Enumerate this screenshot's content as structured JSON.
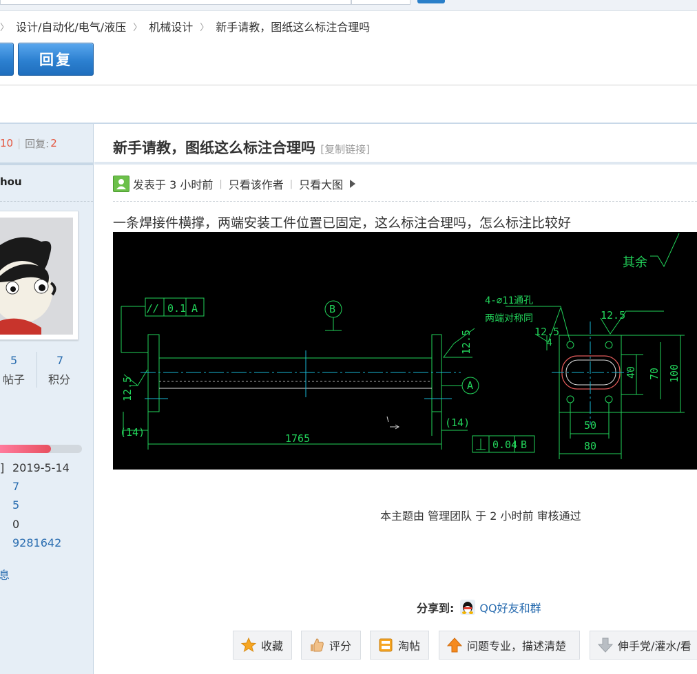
{
  "breadcrumb": {
    "items": [
      "设计/自动化/电气/液压",
      "机械设计",
      "新手请教，图纸这么标注合理吗"
    ]
  },
  "toolbar": {
    "reply_label": "回复"
  },
  "thread_stats": {
    "views_label": "10",
    "replies_prefix": "回复:",
    "replies": "2"
  },
  "author": {
    "name_partial": "hou",
    "posts_count": "5",
    "posts_label": "帖子",
    "points_count": "7",
    "points_label": "积分",
    "level_progress_percent": 62,
    "info_bracket": "]",
    "info_values": [
      "2019-5-14",
      "7",
      "5",
      "0",
      "9281642"
    ],
    "info_link": "息"
  },
  "post": {
    "title": "新手请教，图纸这么标注合理吗",
    "copy_link": "[复制链接]",
    "posted_time": "发表于 3 小时前",
    "only_author": "只看该作者",
    "only_big_image": "只看大图",
    "body": "一条焊接件横撑，两端安装工件位置已固定，这么标注合理吗，怎么标注比较好",
    "audit_note": "本主题由 管理团队 于 2 小时前 审核通过"
  },
  "drawing_labels": {
    "rest": "其余",
    "tol_val": "0.1",
    "tol_ref": "A",
    "datum_b": "B",
    "datum_a": "A",
    "hole_note": "4-⌀11通孔",
    "hole_note2": "两端对称同",
    "rough1": "12.5",
    "rough2": "12.5",
    "rough3": "12.5",
    "rough4": "12.5",
    "dim_4": "4",
    "dim_40": "40",
    "dim_70": "70",
    "dim_100": "100",
    "dim_50": "50",
    "dim_80": "80",
    "dim_14a": "(14)",
    "dim_14b": "(14)",
    "dim_1765": "1765",
    "perp_val": "0.04",
    "perp_ref": "B"
  },
  "share": {
    "label": "分享到:",
    "qq": "QQ好友和群"
  },
  "actions": {
    "favorite": "收藏",
    "rate": "评分",
    "taobao": "淘帖",
    "helpful": "问题专业，描述清楚",
    "low_quality": "伸手党/灌水/看"
  },
  "colors": {
    "accent_blue": "#2c80d0",
    "link_blue": "#2a6db0",
    "stat_red": "#e4553e",
    "cad_green": "#22d35a",
    "cad_cyan": "#19b8d6"
  }
}
